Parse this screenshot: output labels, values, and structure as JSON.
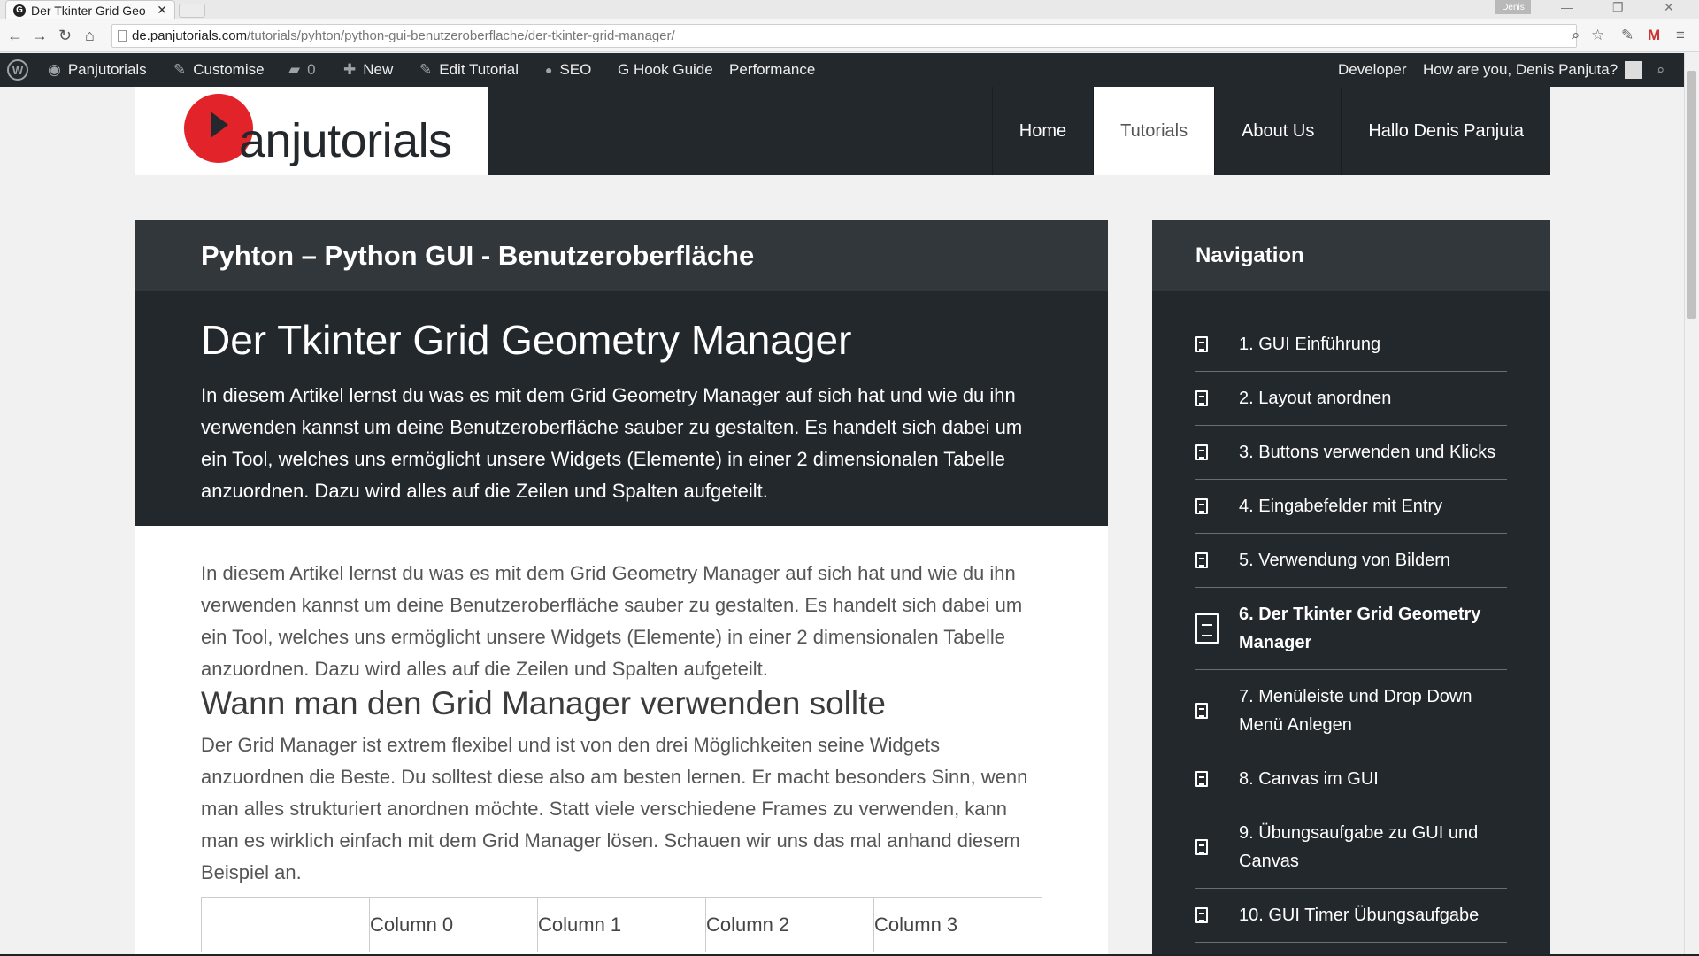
{
  "browser": {
    "tab_title": "Der Tkinter Grid Geo",
    "tab_favicon": "G",
    "profile": "Denis",
    "url_host": "de.panjutorials.com",
    "url_path": "/tutorials/pyhton/python-gui-benutzeroberflache/der-tkinter-grid-manager/"
  },
  "wpbar": {
    "site": "Panjutorials",
    "customise": "Customise",
    "comments": "0",
    "new": "New",
    "edit": "Edit Tutorial",
    "seo": "SEO",
    "hook_guide": "G Hook Guide",
    "performance": "Performance",
    "developer": "Developer",
    "greeting": "How are you, Denis Panjuta?"
  },
  "header": {
    "logo_text": "anjutorials",
    "nav": [
      "Home",
      "Tutorials",
      "About Us",
      "Hallo Denis Panjuta"
    ],
    "active_nav": "Tutorials"
  },
  "content": {
    "category": "Pyhton – Python GUI - Benutzeroberfläche",
    "title": "Der Tkinter Grid Geometry Manager",
    "intro": "In diesem Artikel lernst du was es mit dem Grid Geometry Manager auf sich hat und wie du ihn verwenden kannst um deine Benutzeroberfläche sauber zu gestalten. Es handelt sich dabei um ein Tool, welches uns ermöglicht unsere Widgets (Elemente) in einer 2 dimensionalen Tabelle anzuordnen. Dazu wird alles auf die Zeilen und Spalten aufgeteilt.",
    "paragraph1": "In diesem Artikel lernst du was es mit dem Grid Geometry Manager auf sich hat und wie du ihn verwenden kannst um deine Benutzeroberfläche sauber zu gestalten. Es handelt sich dabei um ein Tool, welches uns ermöglicht unsere Widgets (Elemente) in einer 2 dimensionalen Tabelle anzuordnen. Dazu wird alles auf die Zeilen und Spalten aufgeteilt.",
    "heading2": "Wann man den Grid Manager verwenden sollte",
    "paragraph2": "Der Grid Manager ist extrem flexibel und ist von den drei Möglichkeiten seine Widgets anzuordnen die Beste. Du solltest diese also am besten lernen. Er macht besonders Sinn, wenn man alles strukturiert anordnen möchte. Statt viele verschiedene Frames zu verwenden, kann man es wirklich einfach mit dem Grid Manager lösen. Schauen wir uns das mal anhand diesem Beispiel an.",
    "table_header": [
      "",
      "Column 0",
      "Column 1",
      "Column 2",
      "Column 3"
    ]
  },
  "sidebar": {
    "title": "Navigation",
    "items": [
      "1. GUI Einführung",
      "2. Layout anordnen",
      "3. Buttons verwenden und Klicks",
      "4. Eingabefelder mit Entry",
      "5. Verwendung von Bildern",
      "6. Der Tkinter Grid Geometry Manager",
      "7. Menüleiste und Drop Down Menü Anlegen",
      "8. Canvas im GUI",
      "9. Übungsaufgabe zu GUI und Canvas",
      "10. GUI Timer Übungsaufgabe"
    ],
    "active_index": 5
  },
  "colors": {
    "dark": "#23282d",
    "dark_light": "#32373c",
    "brand_red": "#e2232a"
  }
}
